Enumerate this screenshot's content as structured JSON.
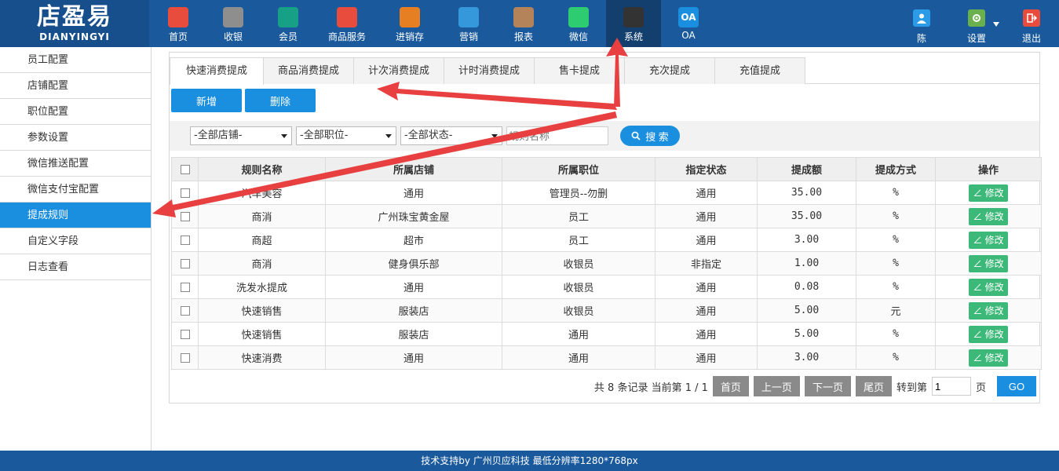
{
  "logo": {
    "cn": "店盈易",
    "en": "DIANYINGYI"
  },
  "nav": [
    {
      "label": "首页",
      "icon": "home-icon",
      "color": "#e74c3c"
    },
    {
      "label": "收银",
      "icon": "cash-register-icon",
      "color": "#8e8e8e"
    },
    {
      "label": "会员",
      "icon": "member-icon",
      "color": "#16a085"
    },
    {
      "label": "商品服务",
      "icon": "goods-icon",
      "color": "#e74c3c"
    },
    {
      "label": "进销存",
      "icon": "inventory-icon",
      "color": "#e67e22"
    },
    {
      "label": "营销",
      "icon": "megaphone-icon",
      "color": "#3498db"
    },
    {
      "label": "报表",
      "icon": "report-icon",
      "color": "#b5835a"
    },
    {
      "label": "微信",
      "icon": "wechat-icon",
      "color": "#2ecc71"
    },
    {
      "label": "系统",
      "icon": "monitor-icon",
      "color": "#333333"
    },
    {
      "label": "OA",
      "icon": "oa-icon",
      "color": "#1a8fe0"
    }
  ],
  "top_right": {
    "user": {
      "label": "陈"
    },
    "settings": {
      "label": "设置"
    },
    "logout": {
      "label": "退出"
    }
  },
  "sidebar": {
    "items": [
      {
        "label": "员工配置"
      },
      {
        "label": "店铺配置"
      },
      {
        "label": "职位配置"
      },
      {
        "label": "参数设置"
      },
      {
        "label": "微信推送配置"
      },
      {
        "label": "微信支付宝配置"
      },
      {
        "label": "提成规则"
      },
      {
        "label": "自定义字段"
      },
      {
        "label": "日志查看"
      }
    ]
  },
  "tabs": [
    {
      "label": "快速消费提成"
    },
    {
      "label": "商品消费提成"
    },
    {
      "label": "计次消费提成"
    },
    {
      "label": "计时消费提成"
    },
    {
      "label": "售卡提成"
    },
    {
      "label": "充次提成"
    },
    {
      "label": "充值提成"
    }
  ],
  "buttons": {
    "add": "新增",
    "delete": "删除"
  },
  "filter": {
    "store": "-全部店铺-",
    "position": "-全部职位-",
    "status": "-全部状态-",
    "rule_placeholder": "规则名称",
    "search": "搜 索"
  },
  "table": {
    "headers": [
      "规则名称",
      "所属店铺",
      "所属职位",
      "指定状态",
      "提成额",
      "提成方式",
      "操作"
    ],
    "edit_label": "修改",
    "rows": [
      {
        "name": "汽车美容",
        "store": "通用",
        "position": "管理员--勿删",
        "status": "通用",
        "amount": "35.00",
        "method": "%"
      },
      {
        "name": "商消",
        "store": "广州珠宝黄金屋",
        "position": "员工",
        "status": "通用",
        "amount": "35.00",
        "method": "%"
      },
      {
        "name": "商超",
        "store": "超市",
        "position": "员工",
        "status": "通用",
        "amount": "3.00",
        "method": "%"
      },
      {
        "name": "商消",
        "store": "健身俱乐部",
        "position": "收银员",
        "status": "非指定",
        "amount": "1.00",
        "method": "%"
      },
      {
        "name": "洗发水提成",
        "store": "通用",
        "position": "收银员",
        "status": "通用",
        "amount": "0.08",
        "method": "%"
      },
      {
        "name": "快速销售",
        "store": "服装店",
        "position": "收银员",
        "status": "通用",
        "amount": "5.00",
        "method": "元"
      },
      {
        "name": "快速销售",
        "store": "服装店",
        "position": "通用",
        "status": "通用",
        "amount": "5.00",
        "method": "%"
      },
      {
        "name": "快速消费",
        "store": "通用",
        "position": "通用",
        "status": "通用",
        "amount": "3.00",
        "method": "%"
      }
    ]
  },
  "pager": {
    "summary": "共 8 条记录 当前第 1 / 1",
    "first": "首页",
    "prev": "上一页",
    "next": "下一页",
    "last": "尾页",
    "goto_label": "转到第",
    "page_value": "1",
    "page_unit": "页",
    "go": "GO"
  },
  "footer": {
    "text": "技术支持by 广州贝应科技    最低分辨率1280*768px"
  },
  "colors": {
    "topbar": "#1a5a9c",
    "accent": "#1a8fe0",
    "edit": "#3cb878",
    "arrow": "#e84040"
  }
}
